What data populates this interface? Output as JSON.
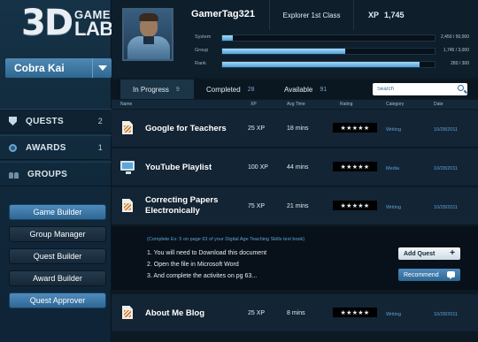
{
  "logo": {
    "big": "3D",
    "line1": "GAME",
    "line2": "LAB"
  },
  "team": {
    "name": "Cobra Kai"
  },
  "nav": [
    {
      "label": "QUESTS",
      "count": "2"
    },
    {
      "label": "AWARDS",
      "count": "1"
    },
    {
      "label": "GROUPS",
      "count": ""
    }
  ],
  "sidebar_buttons": [
    "Game Builder",
    "Group Manager",
    "Quest Builder",
    "Award Builder",
    "Quest Approver"
  ],
  "profile": {
    "gamertag": "GamerTag321",
    "rank_title": "Explorer 1st Class",
    "xp_label": "XP",
    "xp_value": "1,745",
    "stats": [
      {
        "label": "System",
        "value": "2,450 / 50,000",
        "fraction": 0.05
      },
      {
        "label": "Group",
        "value": "1,745 / 3,000",
        "fraction": 0.58
      },
      {
        "label": "Rank",
        "value": "280 / 300",
        "fraction": 0.93
      }
    ]
  },
  "tabs": [
    {
      "label": "In Progress",
      "count": "9"
    },
    {
      "label": "Completed",
      "count": "28"
    },
    {
      "label": "Available",
      "count": "91"
    }
  ],
  "search": {
    "placeholder": "Search"
  },
  "table": {
    "headers": [
      "Name",
      "XP",
      "Avg Time",
      "Rating",
      "Category",
      "Date"
    ],
    "rows": [
      {
        "title": "Google for Teachers",
        "xp": "25 XP",
        "time": "18 mins",
        "rating": "★★★★★",
        "category": "Writing",
        "date": "10/28/2011",
        "icon": "document-icon"
      },
      {
        "title": "YouTube Playlist",
        "xp": "100 XP",
        "time": "44 mins",
        "rating": "★★★★★",
        "category": "Media",
        "date": "10/28/2011",
        "icon": "monitor-icon"
      },
      {
        "title": "Correcting Papers Electronically",
        "xp": "75 XP",
        "time": "21 mins",
        "rating": "★★★★★",
        "category": "Writing",
        "date": "10/28/2011",
        "icon": "document-icon"
      },
      {
        "title": "About Me Blog",
        "xp": "25 XP",
        "time": "8 mins",
        "rating": "★★★★★",
        "category": "Writing",
        "date": "10/28/2011",
        "icon": "document-icon"
      }
    ]
  },
  "detail": {
    "note": "(Complete Ex: 5 on page 63 of your Digital Age Teaching Skills text book)",
    "steps": [
      "1. You will need to Download this document",
      "2. Open the file in Microsoft Word",
      "3. And complete the activites on pg 63..."
    ],
    "add_label": "Add Quest",
    "recommend_label": "Recommend"
  },
  "colors": {
    "accent": "#4f8bbd",
    "link": "#5aa2d8",
    "panel": "#132434"
  }
}
